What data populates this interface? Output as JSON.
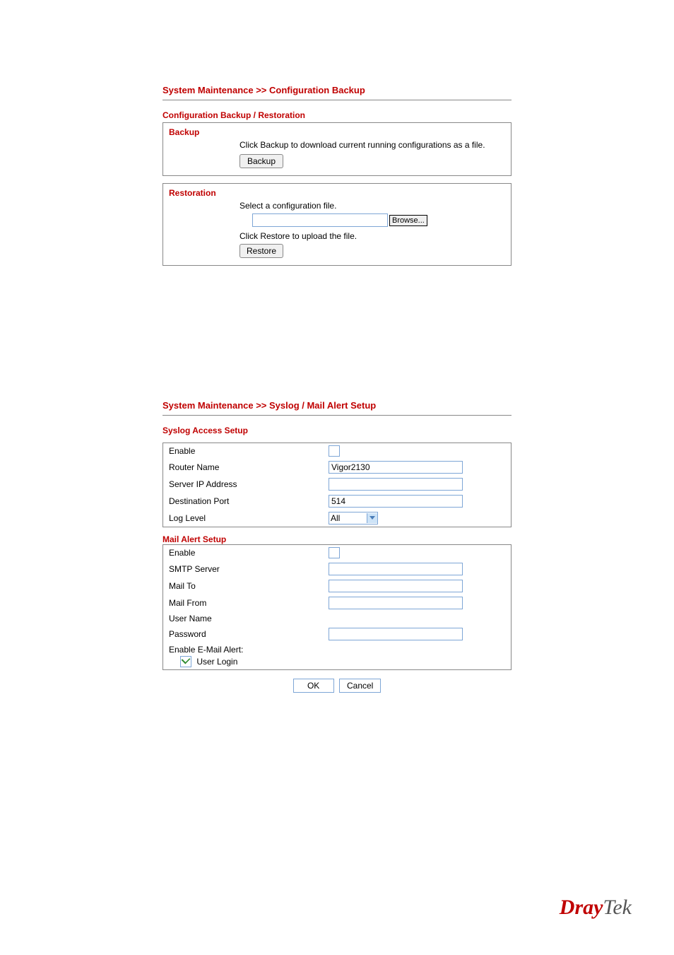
{
  "section1": {
    "breadcrumb": "System Maintenance >> Configuration Backup",
    "title": "Configuration Backup / Restoration",
    "backup": {
      "label": "Backup",
      "text": "Click Backup to download current running configurations as a file.",
      "button": "Backup"
    },
    "restoration": {
      "label": "Restoration",
      "select_text": "Select a configuration file.",
      "browse_button": "Browse...",
      "restore_text": "Click Restore to upload the file.",
      "restore_button": "Restore"
    }
  },
  "section2": {
    "breadcrumb": "System Maintenance >> Syslog / Mail Alert Setup",
    "syslog": {
      "title": "Syslog Access Setup",
      "rows": {
        "enable_label": "Enable",
        "enable_checked": false,
        "router_name_label": "Router Name",
        "router_name_value": "Vigor2130",
        "server_ip_label": "Server IP Address",
        "server_ip_value": "",
        "dest_port_label": "Destination Port",
        "dest_port_value": "514",
        "log_level_label": "Log Level",
        "log_level_value": "All"
      }
    },
    "mail": {
      "title": "Mail Alert Setup",
      "rows": {
        "enable_label": "Enable",
        "enable_checked": false,
        "smtp_label": "SMTP Server",
        "smtp_value": "",
        "mailto_label": "Mail To",
        "mailto_value": "",
        "mailfrom_label": "Mail From",
        "mailfrom_value": "",
        "username_label": "User Name",
        "username_value": "",
        "password_label": "Password",
        "password_value": "",
        "email_alert_label": "Enable E-Mail Alert:",
        "user_login_label": "User Login",
        "user_login_checked": true
      }
    },
    "buttons": {
      "ok": "OK",
      "cancel": "Cancel"
    }
  },
  "logo": {
    "part1": "Dray",
    "part2": "Tek"
  }
}
